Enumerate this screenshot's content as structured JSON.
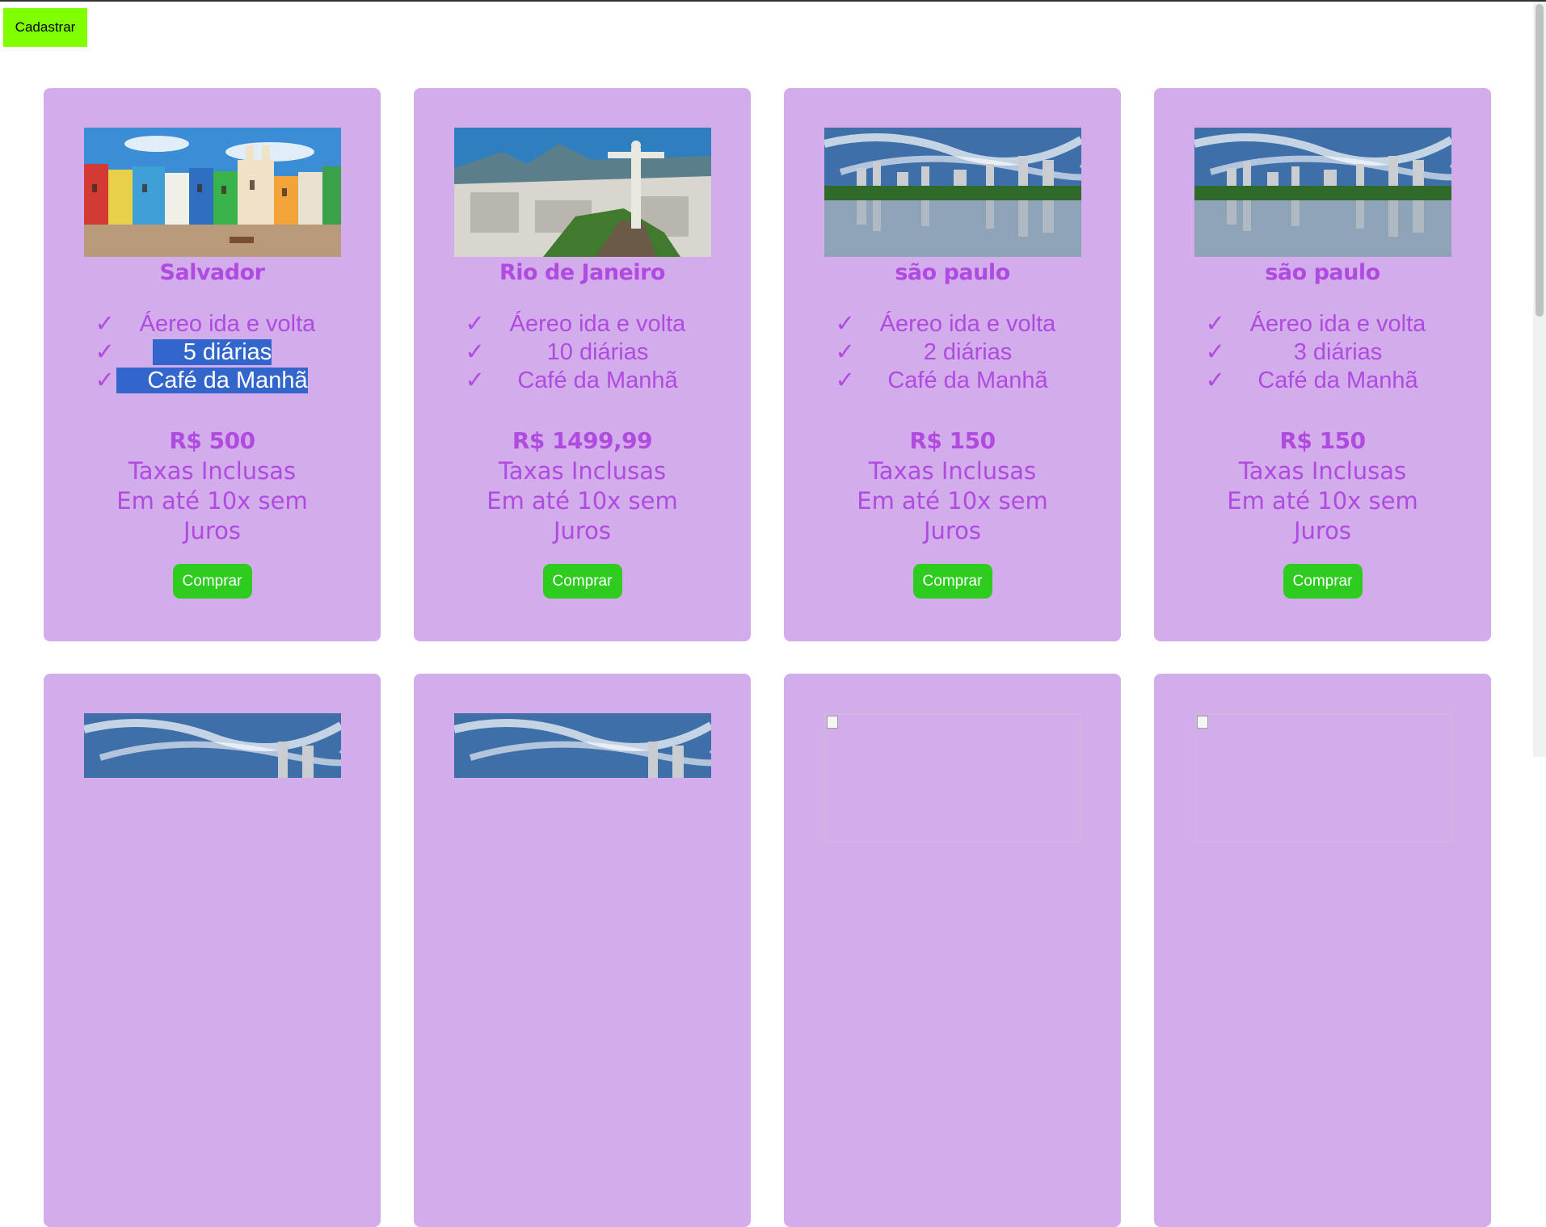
{
  "header": {
    "cadastrar_label": "Cadastrar"
  },
  "cards": [
    {
      "image": "salvador-photo",
      "city": "Salvador",
      "features": [
        {
          "check": "✓",
          "text": "Áereo ida e volta"
        },
        {
          "check": "✓",
          "text": "5 diárias"
        },
        {
          "check": "✓",
          "text": "Café da Manhã"
        }
      ],
      "price": "R$ 500",
      "tax": "Taxas Inclusas",
      "installments": "Em até 10x sem Juros",
      "buy_label": "Comprar"
    },
    {
      "image": "rio-photo",
      "city": "Rio de Janeiro",
      "features": [
        {
          "check": "✓",
          "text": "Áereo ida e volta"
        },
        {
          "check": "✓",
          "text": "10 diárias"
        },
        {
          "check": "✓",
          "text": "Café da Manhã"
        }
      ],
      "price": "R$ 1499,99",
      "tax": "Taxas Inclusas",
      "installments": "Em até 10x sem Juros",
      "buy_label": "Comprar"
    },
    {
      "image": "sao-paulo-photo",
      "city": "são paulo",
      "features": [
        {
          "check": "✓",
          "text": "Áereo ida e volta"
        },
        {
          "check": "✓",
          "text": "2 diárias"
        },
        {
          "check": "✓",
          "text": "Café da Manhã"
        }
      ],
      "price": "R$ 150",
      "tax": "Taxas Inclusas",
      "installments": "Em até 10x sem Juros",
      "buy_label": "Comprar"
    },
    {
      "image": "sao-paulo-photo",
      "city": "são paulo",
      "features": [
        {
          "check": "✓",
          "text": "Áereo ida e volta"
        },
        {
          "check": "✓",
          "text": "3 diárias"
        },
        {
          "check": "✓",
          "text": "Café da Manhã"
        }
      ],
      "price": "R$ 150",
      "tax": "Taxas Inclusas",
      "installments": "Em até 10x sem Juros",
      "buy_label": "Comprar"
    },
    {
      "image": "sao-paulo-photo"
    },
    {
      "image": "sao-paulo-photo"
    },
    {
      "image": "broken-image"
    },
    {
      "image": "broken-image"
    }
  ],
  "colors": {
    "card_bg": "#d3aceb",
    "accent_text": "#b04ae0",
    "buy_button": "#2ecc1f",
    "cadastrar_button": "#80ff00",
    "selection": "#3366cc"
  }
}
